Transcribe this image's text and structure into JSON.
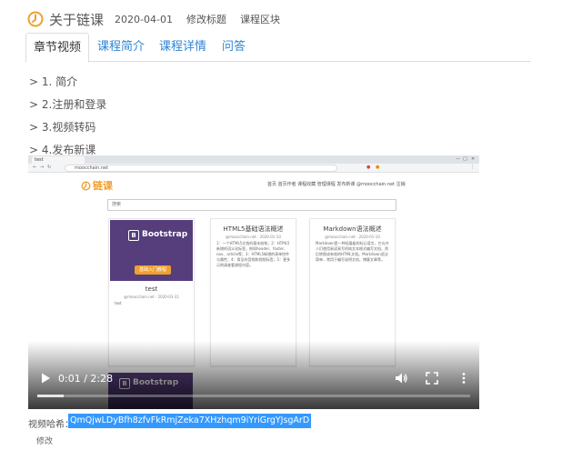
{
  "header": {
    "title": "关于链课",
    "date": "2020-04-01",
    "edit_title": "修改标题",
    "course_block": "课程区块",
    "logo_icon": "clock-logo-icon",
    "accent": "#f0a030"
  },
  "tabs": [
    {
      "label": "章节视频",
      "active": true
    },
    {
      "label": "课程简介",
      "active": false
    },
    {
      "label": "课程详情",
      "active": false
    },
    {
      "label": "问答",
      "active": false
    }
  ],
  "chapters": [
    "> 1. 简介",
    "> 2.注册和登录",
    "> 3.视频转码",
    "> 4.发布新课"
  ],
  "video": {
    "browser_tab": "test",
    "address": "moocchain.net",
    "site_logo": "链课",
    "site_nav": "首页   首页作者   课程收藏   管理课程   发布新课   @moocchain.net   注销",
    "search_placeholder": "搜索",
    "cards": [
      {
        "badge": "B",
        "badge_word": "Bootstrap",
        "button": "基础入门教程",
        "title": "test",
        "meta": "@moocchain.net · 2020-03-31",
        "desc": "test"
      },
      {
        "title": "HTML5基础语法概述",
        "meta": "@moocchain.net · 2020-01-10",
        "desc": "1：一个HTML5文档的基本结构；2：HTML5新增的语义化标签，例如header、footer、nav、article等；3：HTML5新增的表单控件与属性；4：常见的音频和视频标签；5：更多示例请查看课程内容。"
      },
      {
        "title": "Markdown语法概述",
        "meta": "@moocchain.net · 2020-01-10",
        "desc": "Markdown是一种轻量级的标记语言，它允许人们使用易读易写的纯文本格式编写文档，然后转换成有效的HTML文档。Markdown语法简单，常用于编写说明文档、博客文章等。"
      }
    ],
    "time_display": "0:01 / 2:28",
    "progress": 0.06,
    "play_icon": "play-icon",
    "volume_icon": "volume-icon",
    "fullscreen_icon": "fullscreen-icon",
    "more_icon": "more-vertical-icon"
  },
  "video_key": {
    "label": "视频哈希：",
    "value": "QmQjwLDyBfh8zfvFkRmjZeka7XHzhqm9iYriGrgYJsgArD",
    "edit": "修改"
  }
}
